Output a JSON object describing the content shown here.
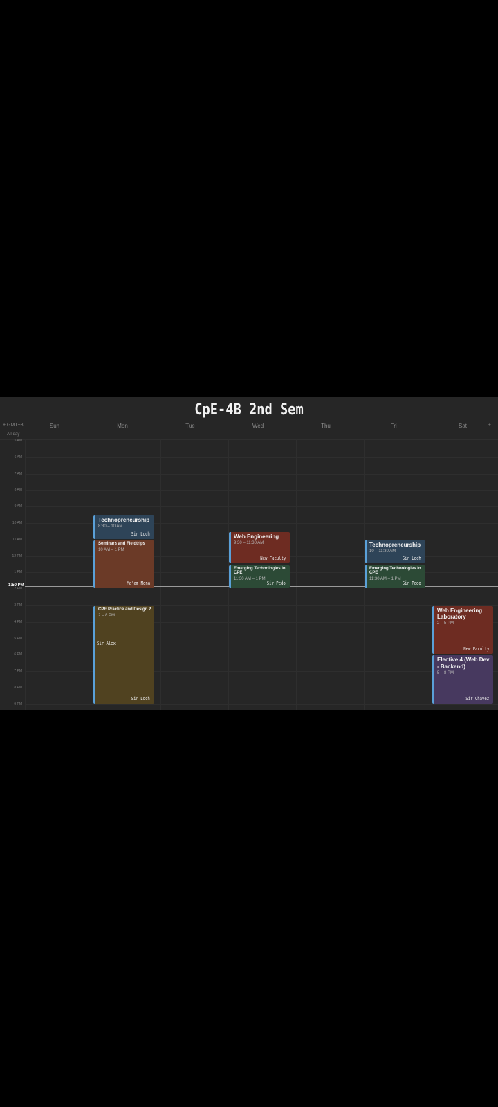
{
  "title": "CpE-4B 2nd Sem",
  "header": {
    "left_controls": "+  GMT+8",
    "right_control": "±",
    "days": [
      "Sun",
      "Mon",
      "Tue",
      "Wed",
      "Thu",
      "Fri",
      "Sat"
    ]
  },
  "allday_label": "All-day",
  "hours": [
    "5 AM",
    "6 AM",
    "7 AM",
    "8 AM",
    "9 AM",
    "10 AM",
    "11 AM",
    "12 PM",
    "1 PM",
    "2 PM",
    "3 PM",
    "4 PM",
    "5 PM",
    "6 PM",
    "7 PM",
    "8 PM",
    "9 PM"
  ],
  "now_label": "1:50 PM",
  "colors": {
    "blue": "#2e4458",
    "brown": "#6b3a27",
    "red": "#6e2c22",
    "green": "#2c4a36",
    "olive": "#504220",
    "purple": "#47395f",
    "accent": "#5aa0d8"
  },
  "events": [
    {
      "day": 1,
      "start": 9.5,
      "end": 11,
      "title": "Technopreneurship",
      "time": "8:30 – 10 AM",
      "who": "Sir Loch",
      "color": "blue"
    },
    {
      "day": 1,
      "start": 11,
      "end": 14,
      "title": "Seminars and Fieldtrips",
      "time": "10 AM – 1 PM",
      "who": "Ma'am Mona",
      "color": "brown",
      "small": true
    },
    {
      "day": 1,
      "start": 15,
      "end": 21,
      "title": "CPE Practice and Design 2",
      "time": "2 – 8 PM",
      "who": "Sir Loch",
      "who2": "Sir Alex",
      "color": "olive",
      "small": true
    },
    {
      "day": 3,
      "start": 10.5,
      "end": 12.5,
      "title": "Web Engineering",
      "time": "9:30 – 11:30 AM",
      "who": "New Faculty",
      "color": "red"
    },
    {
      "day": 3,
      "start": 12.5,
      "end": 14,
      "title": "Emerging Technologies in CPE",
      "time": "11:30 AM – 1 PM",
      "who": "Sir Pedo",
      "color": "green",
      "small": true
    },
    {
      "day": 5,
      "start": 11,
      "end": 12.5,
      "title": "Technopreneurship",
      "time": "10 – 11:30 AM",
      "who": "Sir Loch",
      "color": "blue"
    },
    {
      "day": 5,
      "start": 12.5,
      "end": 14,
      "title": "Emerging Technologies in CPE",
      "time": "11:30 AM – 1 PM",
      "who": "Sir Pedo",
      "color": "green",
      "small": true
    },
    {
      "day": 6,
      "start": 15,
      "end": 18,
      "title": "Web Engineering Laboratory",
      "time": "2 – 5 PM",
      "who": "New Faculty",
      "color": "red"
    },
    {
      "day": 6,
      "start": 18,
      "end": 21,
      "title": "Elective 4 (Web Dev - Backend)",
      "time": "5 – 8 PM",
      "who": "Sir Chavez",
      "color": "purple"
    }
  ]
}
